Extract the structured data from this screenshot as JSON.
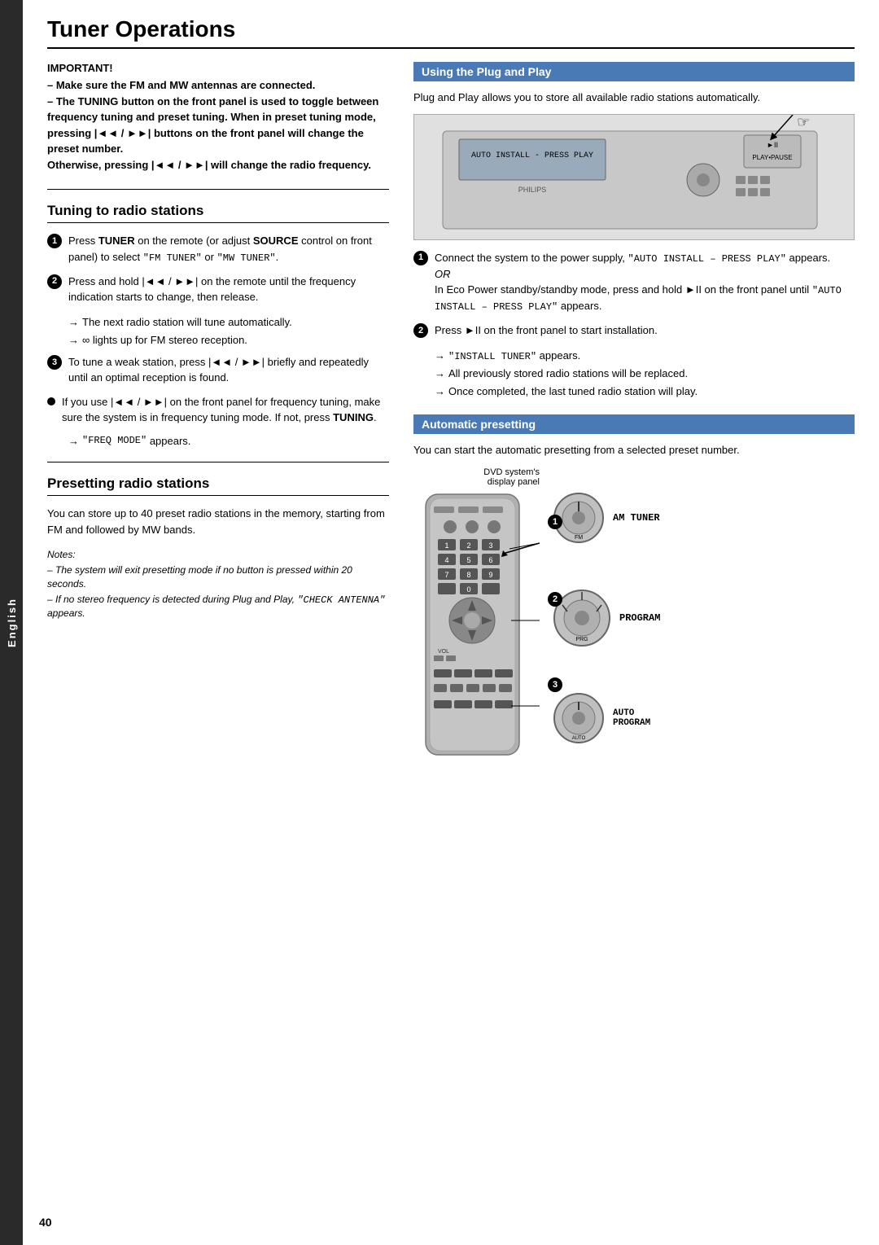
{
  "sidebar": {
    "label": "English"
  },
  "page": {
    "title": "Tuner Operations",
    "page_number": "40"
  },
  "left_col": {
    "important": {
      "title": "IMPORTANT!",
      "lines": [
        "– Make sure the FM and MW antennas are connected.",
        "– The TUNING button on the front panel is used to toggle between frequency tuning and preset tuning. When in preset tuning mode, pressing |◄◄ / ►► | buttons on the front panel will change the preset number.",
        "Otherwise, pressing |◄◄ / ►► | will change the radio frequency."
      ]
    },
    "tuning_section": {
      "heading": "Tuning to radio stations",
      "steps": [
        {
          "num": "1",
          "text": "Press TUNER on the remote (or adjust SOURCE control on front panel) to select \"FM TUNER\" or \"MW TUNER\"."
        },
        {
          "num": "2",
          "text": "Press and hold |◄◄ / ►► | on the remote until the frequency indication starts to change, then release."
        }
      ],
      "arrows": [
        "The next radio station will tune automatically.",
        "∞ lights up for FM stereo reception."
      ],
      "step3": {
        "num": "3",
        "text": "To tune a weak station, press |◄◄ / ►► | briefly and repeatedly until an optimal reception is found."
      },
      "bullet_step": {
        "text": "If you use |◄◄ / ►► | on the front panel for frequency tuning, make sure the system is in frequency tuning mode. If not, press TUNING."
      },
      "tuning_arrow": "\"FREQ MODE\" appears."
    },
    "presetting_section": {
      "heading": "Presetting radio stations",
      "intro": "You can store up to 40 preset radio stations in the memory, starting from FM and followed by MW bands.",
      "notes_title": "Notes:",
      "notes": [
        "– The system will exit presetting mode if no button is pressed within 20 seconds.",
        "– If no stereo frequency is detected during Plug and Play, \"CHECK ANTENNA\" appears."
      ]
    }
  },
  "right_col": {
    "plug_play_section": {
      "heading": "Using the Plug and Play",
      "intro": "Plug and Play allows you to store all available radio stations automatically.",
      "device_label": "AUTO INSTALL – PRESS PLAY",
      "steps": [
        {
          "num": "1",
          "text": "Connect the system to the power supply, \"AUTO INSTALL – PRESS PLAY\" appears.",
          "or_text": "OR",
          "eco_text": "In Eco Power standby/standby mode, press and hold ►II on the front panel until \"AUTO INSTALL – PRESS PLAY\" appears."
        },
        {
          "num": "2",
          "text": "Press ►II on the front panel to start installation."
        }
      ],
      "arrows": [
        "→ \"INSTALL TUNER\" appears.",
        "→ All previously stored radio stations will be replaced.",
        "→ Once completed, the last tuned radio station will play."
      ]
    },
    "auto_presetting_section": {
      "heading": "Automatic presetting",
      "intro": "You can start the automatic presetting from a selected preset number.",
      "dvd_label": "DVD system's display panel",
      "dial_labels": [
        {
          "num": "1",
          "text": "AM TUNER"
        },
        {
          "num": "2",
          "text": "PROGRAM"
        },
        {
          "num": "3",
          "text": "AUTO PROGRAM"
        }
      ]
    }
  }
}
